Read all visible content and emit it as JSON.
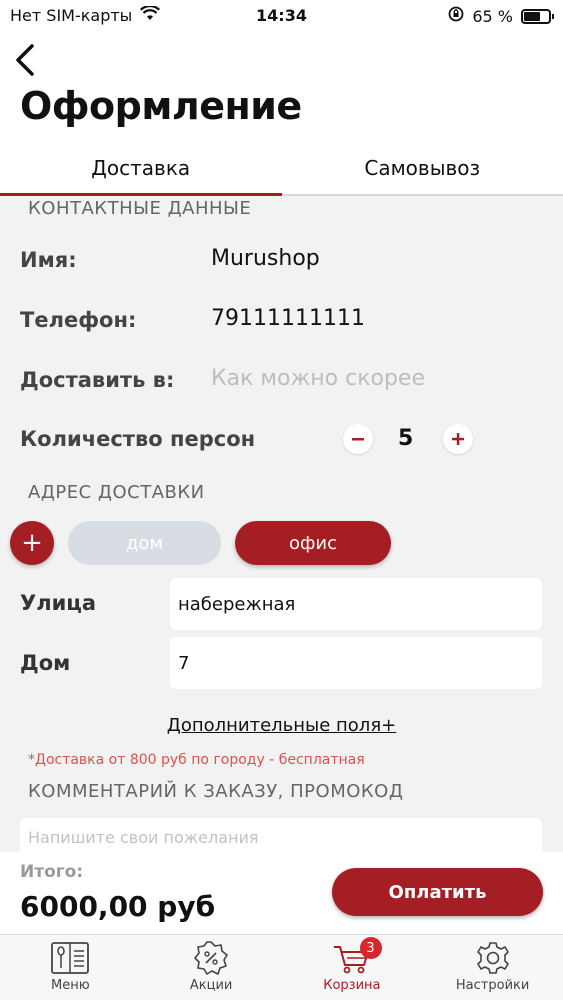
{
  "status_bar": {
    "carrier": "Нет SIM-карты",
    "time": "14:34",
    "battery": "65 %",
    "battery_level": 0.65
  },
  "header": {
    "title": "Оформление"
  },
  "tabs": [
    {
      "label": "Доставка",
      "active": true
    },
    {
      "label": "Самовывоз",
      "active": false
    }
  ],
  "contact": {
    "section_title": "КОНТАКТНЫЕ ДАННЫЕ",
    "name_label": "Имя:",
    "name_value": "Murushop",
    "phone_label": "Телефон:",
    "phone_value": "79111111111",
    "deliver_label": "Доставить в:",
    "deliver_placeholder": "Как можно скорее",
    "persons_label": "Количество персон",
    "persons_count": "5"
  },
  "address": {
    "section_title": "АДРЕС ДОСТАВКИ",
    "add_label": "+",
    "options": [
      {
        "label": "дом",
        "active": false
      },
      {
        "label": "офис",
        "active": true
      }
    ],
    "street_label": "Улица",
    "street_value": "набережная",
    "house_label": "Дом",
    "house_value": "7"
  },
  "extra_fields_link": "Дополнительные поля+",
  "delivery_note": "*Доставка от 800 руб  по городу - бесплатная",
  "comment": {
    "section_title": "КОММЕНТАРИЙ К ЗАКАЗУ, ПРОМОКОД",
    "placeholder": "Напишите свои пожелания"
  },
  "footer": {
    "total_label": "Итого:",
    "total_value": "6000,00 руб",
    "pay_label": "Оплатить"
  },
  "tabbar": {
    "items": [
      {
        "label": "Меню",
        "icon": "menu-book-icon"
      },
      {
        "label": "Акции",
        "icon": "discount-gear-icon"
      },
      {
        "label": "Корзина",
        "icon": "cart-icon",
        "badge": "3",
        "active": true
      },
      {
        "label": "Настройки",
        "icon": "settings-gear-icon"
      }
    ]
  },
  "colors": {
    "accent": "#a51e24",
    "badge": "#d9262c",
    "note": "#d9534f",
    "inactive_pill": "#d8dde3"
  }
}
